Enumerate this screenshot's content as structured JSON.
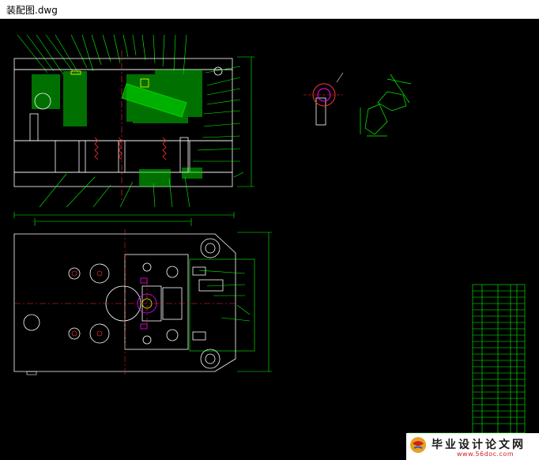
{
  "window": {
    "title": "装配图.dwg"
  },
  "watermark": {
    "text": "毕业设计论文网",
    "url": "www.56doc.com",
    "logo_icon": "globe-icon"
  },
  "colors": {
    "background": "#000000",
    "line_green": "#00ff00",
    "line_white": "#ffffff",
    "line_red": "#ff3030",
    "line_magenta": "#ff00ff",
    "line_yellow": "#ffff00"
  }
}
